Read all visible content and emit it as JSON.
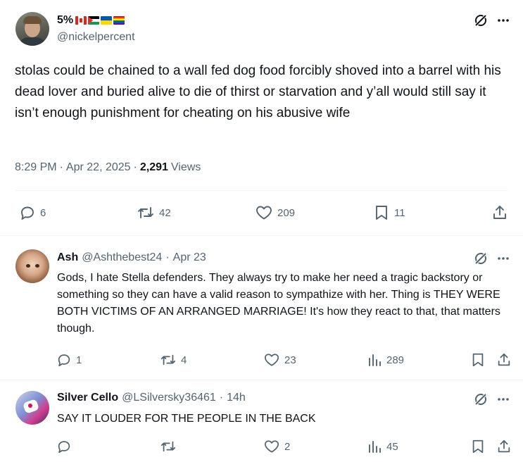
{
  "main_post": {
    "display_name": "5%",
    "handle": "@nickelpercent",
    "text": "stolas could be chained to a wall fed dog food forcibly shoved into a barrel with his dead lover and buried alive to die of thirst or starvation and y’all would still say it isn’t enough punishment for cheating on his abusive wife",
    "time": "8:29 PM",
    "date": "Apr 22, 2025",
    "views_count": "2,291",
    "views_label": "Views",
    "replies": "6",
    "reposts": "42",
    "likes": "209",
    "bookmarks": "11",
    "name_flags": [
      "flag-canada-icon",
      "flag-palestine-icon",
      "flag-ukraine-icon",
      "flag-rainbow-icon"
    ]
  },
  "replies": [
    {
      "display_name": "Ash",
      "handle": "@Ashthebest24",
      "time": "Apr 23",
      "text": "Gods, I hate Stella defenders. They always try to make her need a tragic backstory or something so they can have a valid reason to sympathize with her. Thing is THEY WERE BOTH VICTIMS OF AN ARRANGED MARRIAGE! It's how they react to that, that matters though.",
      "replies": "1",
      "reposts": "4",
      "likes": "23",
      "views": "289"
    },
    {
      "display_name": "Silver Cello",
      "handle": "@LSilversky36461",
      "time": "14h",
      "text": "SAY IT LOUDER FOR THE PEOPLE IN THE BACK",
      "replies": "",
      "reposts": "",
      "likes": "2",
      "views": "45"
    }
  ],
  "separator": "·",
  "colors": {
    "text": "#0f1419",
    "muted": "#536471",
    "divider": "#eff3f4"
  }
}
